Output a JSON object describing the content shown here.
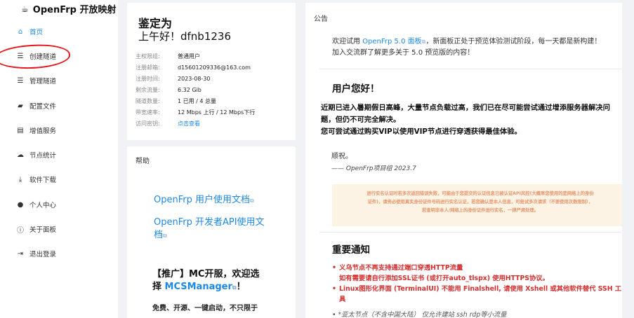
{
  "sidebar": {
    "brand": "OpenFrp 开放映射",
    "items": [
      {
        "label": "首页",
        "icon": "home-icon",
        "glyph": "⌂"
      },
      {
        "label": "创建隧道",
        "icon": "list-icon",
        "glyph": "☰"
      },
      {
        "label": "管理隧道",
        "icon": "list-icon",
        "glyph": "☰"
      },
      {
        "label": "配置文件",
        "icon": "file-icon",
        "glyph": "▰"
      },
      {
        "label": "增值服务",
        "icon": "stack-icon",
        "glyph": "▤"
      },
      {
        "label": "节点统计",
        "icon": "cloud-icon",
        "glyph": "☁"
      },
      {
        "label": "软件下载",
        "icon": "download-icon",
        "glyph": "⤓"
      },
      {
        "label": "个人中心",
        "icon": "user-icon",
        "glyph": "●"
      },
      {
        "label": "关于面板",
        "icon": "info-icon",
        "glyph": "ⓘ"
      },
      {
        "label": "退出登录",
        "icon": "logout-icon",
        "glyph": "⇥"
      }
    ],
    "active_index": 0
  },
  "profile": {
    "title": "鉴定为",
    "greeting": "上午好！dfnb1236",
    "rows": [
      {
        "k": "主权限组:",
        "v": "普通用户"
      },
      {
        "k": "注册邮箱:",
        "v": "d15601209336@163.com"
      },
      {
        "k": "注册时间:",
        "v": "2023-08-30"
      },
      {
        "k": "剩余流量:",
        "v": "6.32 Gib"
      },
      {
        "k": "隧道数量:",
        "v": "1 已用 / 4 总量"
      },
      {
        "k": "带宽速率:",
        "v": "12 Mbps 上行 / 12 Mbps下行"
      },
      {
        "k": "访问密钥:",
        "v": "点击查看"
      }
    ]
  },
  "help": {
    "title": "帮助",
    "link1": "OpenFrp 用户使用文档",
    "link2a": "OpenFrp 开发者API使用文",
    "link2b": "档",
    "ext": "⧉",
    "promo_line1": "【推广】MC开服，欢迎选",
    "promo_line2_pre": "择 ",
    "promo_brand": "MCSManager",
    "promo_line2_post": "！",
    "promo_desc": "免费、开源、一键启动，不只限于"
  },
  "notice": {
    "title": "公告",
    "welcome_pre": "欢迎试用 ",
    "welcome_link": "OpenFrp 5.0 面板",
    "welcome_post": "，新面板正处于预览体验测试阶段，每一天都是新构建！",
    "welcome_line2": "加入交流群了解更多关于 5.0 预览版的内容！",
    "hello": "用户您好！",
    "bold1": "近期已进入暑期假日高峰，大量节点负载过高，我们已在尽可能尝试通过增添服务器解决问",
    "bold2": "题，但仍不可完全解决。",
    "bold3": "您可尝试通过购买VIP以使用VIP节点进行穿透获得最佳体验。",
    "regards": "顺祝。",
    "signature": "—— OpenFrp项目组 2023.7",
    "warn1": "进行实名认证时若多次返回错误失败，可能由于您提交的认证信息已被认证API风控(大概率您使用的是网络上的身份",
    "warn2": "证件)，请务必使用真实身份证件号码进行实名认证，若您确认是本人信息，可尝试多次请求（不要使用次数限制），",
    "warn3": "若查明非本人/网络上的身份证件进行实名，一律严肃处理。",
    "important": "重要通知",
    "red1": "义乌节点不再支持通过端口穿透HTTP流量",
    "red2": "如有需要请自行添加SSL证书 (或打开auto_tlspx) 使用HTTPS协议。",
    "red3": "Linux图形化界面 (TerminalUI) 不能用 Finalshell, 请使用 Xshell 或其他软件替代 SSH 工具",
    "gray1": "*亚太节点（不含中国大陆） 仅允许建站 ssh rdp等小流量"
  }
}
